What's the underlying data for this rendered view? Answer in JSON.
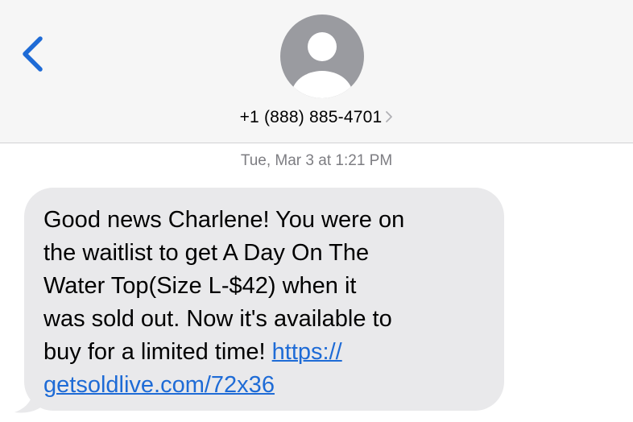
{
  "header": {
    "back_icon": "chevron-left-icon",
    "avatar_icon": "person-silhouette-icon",
    "contact": "+1 (888) 885-4701",
    "details_icon": "chevron-right-icon"
  },
  "conversation": {
    "timestamp_day": "Tue, Mar 3",
    "timestamp_at": "at",
    "timestamp_time": "1:21 PM",
    "message": {
      "text": "Good news Charlene! You were on\nthe waitlist to get A Day On The\nWater Top(Size L-$42) when it\nwas sold out. Now it's available to\nbuy for a limited time! ",
      "link_line1": "https://",
      "link_line2": "getsoldlive.com/72x36"
    }
  },
  "colors": {
    "header_bg": "#f6f6f6",
    "accent": "#1e6bd6",
    "bubble_bg": "#e9e9eb",
    "avatar_bg": "#9a9ba0",
    "timestamp": "#7d7d82"
  }
}
